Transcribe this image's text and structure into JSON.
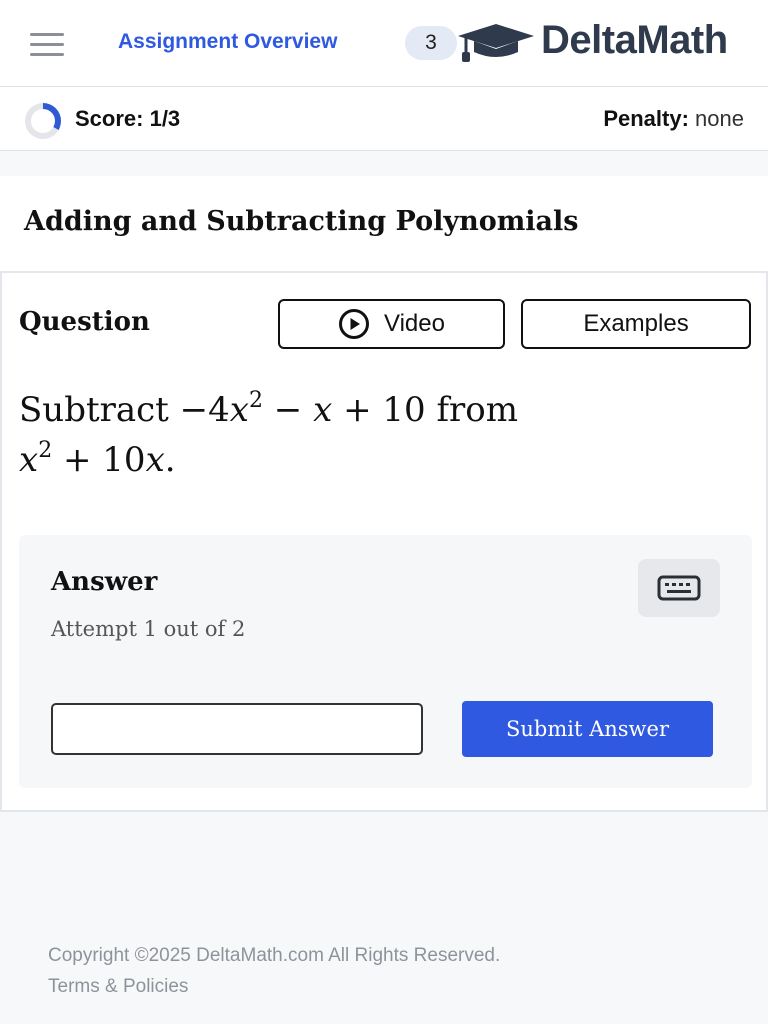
{
  "header": {
    "assignment_link": "Assignment Overview",
    "count_badge": "3",
    "logo_text": "DeltaMath"
  },
  "scorebar": {
    "score": "Score: 1/3",
    "score_fraction": 0.333,
    "penalty_label": "Penalty:",
    "penalty_value": "none"
  },
  "problem_title": "Adding and Subtracting Polynomials",
  "question": {
    "label": "Question",
    "video_label": "Video",
    "examples_label": "Examples",
    "prompt": {
      "word_subtract": "Subtract",
      "sign1": "−4",
      "var1": "x",
      "exp1": "2",
      "op1": " − ",
      "var2": "x",
      "op2": " + 10",
      "word_from": "from",
      "var3": "x",
      "exp2": "2",
      "op3": " + 10",
      "var4": "x",
      "end": "."
    }
  },
  "answer": {
    "label": "Answer",
    "attempt": "Attempt 1 out of 2",
    "input_value": "",
    "submit_label": "Submit Answer"
  },
  "footer": {
    "copyright": "Copyright ©2025 DeltaMath.com All Rights Reserved.",
    "terms": "Terms & Policies"
  },
  "icons": {
    "menu": "hamburger-icon",
    "logo": "graduation-cap-icon",
    "score": "progress-ring-icon",
    "video": "play-circle-icon",
    "keyboard": "keyboard-icon"
  },
  "colors": {
    "accent": "#2f59e0",
    "logo": "#2f3a4c",
    "badge_bg": "#e3e9f5"
  }
}
